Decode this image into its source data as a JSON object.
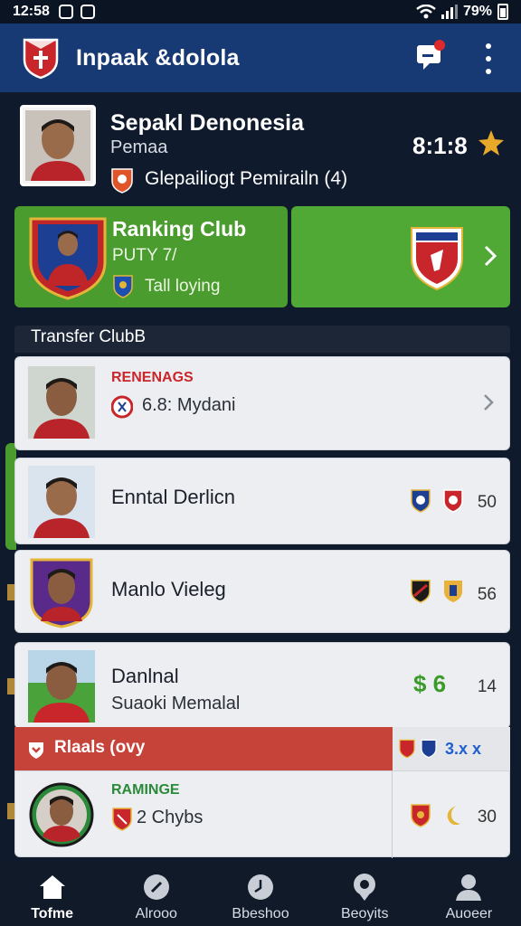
{
  "status": {
    "time": "12:58",
    "battery": "79%"
  },
  "app": {
    "title": "Inpaak &dolola"
  },
  "profile": {
    "name": "Sepakl Denonesia",
    "subtitle": "Pemaa",
    "stat_label": "Glepailiogt Pemirailn (4)",
    "score": "8:1:8"
  },
  "ranking_card": {
    "title": "Ranking Club",
    "subtitle": "PUTY 7/",
    "tag": "Tall loying"
  },
  "section": {
    "title": "Transfer ClubB"
  },
  "rows": [
    {
      "label_top": "RENENAGS",
      "text": "6.8: Mydani"
    },
    {
      "text": "Enntal Derlicn",
      "num": "50"
    },
    {
      "text": "Manlo Vieleg",
      "num": "56"
    },
    {
      "text": "Danlnal",
      "subtext": "Suaoki Memalal",
      "money": "$ 6",
      "num": "14"
    },
    {
      "label_top": "RAMINGE",
      "text": "2 Chybs",
      "num": "30"
    }
  ],
  "promo": {
    "text": "Rlaals (ovy",
    "right": "3.x x"
  },
  "nav": [
    {
      "label": "Tofme",
      "icon": "home-icon"
    },
    {
      "label": "Alrooo",
      "icon": "football-icon"
    },
    {
      "label": "Bbeshoo",
      "icon": "clock-icon"
    },
    {
      "label": "Beoyits",
      "icon": "medal-icon"
    },
    {
      "label": "Auoeer",
      "icon": "user-icon"
    }
  ],
  "colors": {
    "app_bar": "#173a75",
    "background": "#0f1a2c",
    "green_card": "#4a9c2e",
    "promo_red": "#c6433a"
  }
}
